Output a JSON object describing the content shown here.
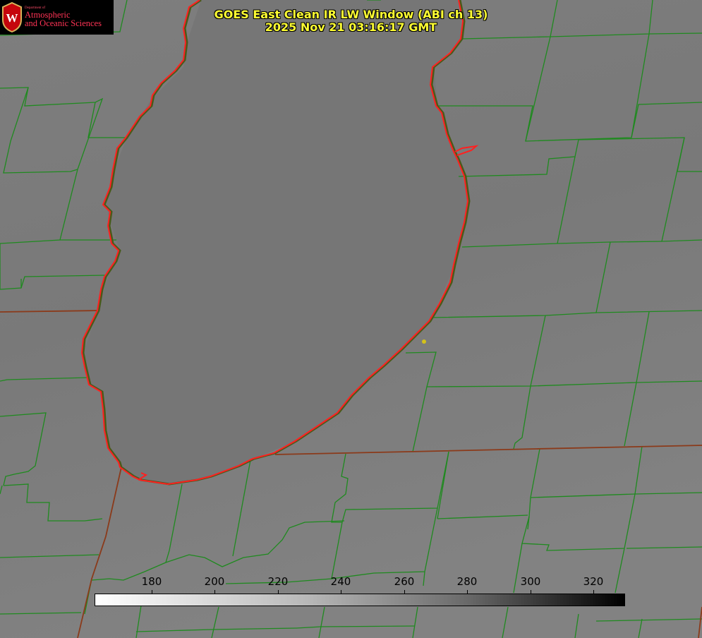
{
  "title": {
    "line1": "GOES East Clean IR LW Window (ABI ch 13)",
    "line2": "2025 Nov 21 03:16:17 GMT"
  },
  "logo": {
    "small": "Department of",
    "line1": "Atmospheric",
    "line2": "and Oceanic Sciences",
    "seal_letter": "W"
  },
  "colorbar": {
    "ticks": [
      "180",
      "200",
      "220",
      "240",
      "260",
      "280",
      "300",
      "320"
    ]
  },
  "colors": {
    "background": "#7a7a7a",
    "county_lines": "#1f8a1f",
    "state_lines": "#8b3a1a",
    "coastline": "#ff2020",
    "title": "#ffff33",
    "marker": "#d4c21a"
  }
}
